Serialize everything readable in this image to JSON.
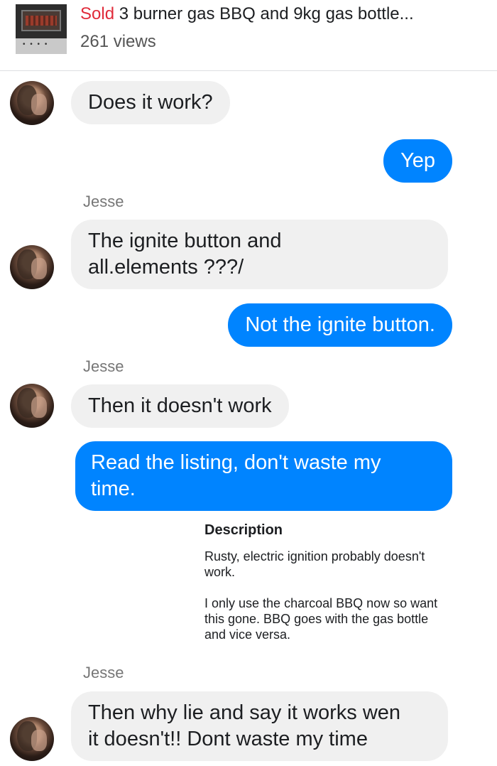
{
  "listing": {
    "status": "Sold",
    "title": "3 burner gas BBQ and 9kg gas bottle...",
    "views": "261 views"
  },
  "messages": [
    {
      "from": "them",
      "text": "Does it work?"
    },
    {
      "from": "me",
      "text": "Yep"
    },
    {
      "from": "them",
      "sender": "Jesse",
      "text": "The ignite button and\nall.elements ???/"
    },
    {
      "from": "me",
      "text": "Not the ignite button."
    },
    {
      "from": "them",
      "sender": "Jesse",
      "text": "Then it doesn't work"
    },
    {
      "from": "me",
      "text": "Read the listing, don't waste my\ntime."
    },
    {
      "from": "them",
      "sender": "Jesse",
      "text": "Then why lie and say it works wen\nit doesn't!! Dont waste my time"
    }
  ],
  "description": {
    "heading": "Description",
    "paragraph1": "Rusty, electric ignition probably doesn't\nwork.",
    "paragraph2": "I only use the charcoal BBQ now so want\nthis gone. BBQ goes with the gas bottle\nand vice versa."
  },
  "colors": {
    "outgoing": "#0084ff",
    "incoming": "#f0f0f0",
    "sold": "#e02b3a"
  }
}
